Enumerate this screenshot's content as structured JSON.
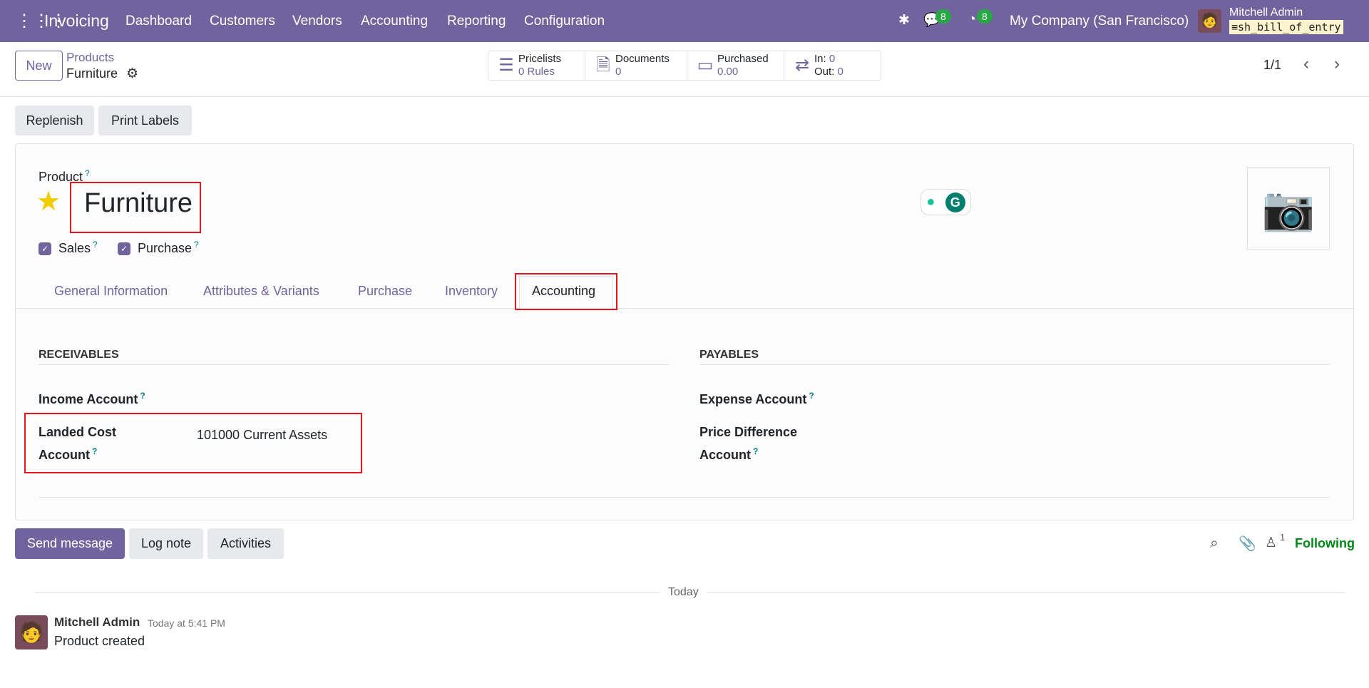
{
  "nav": {
    "app": "Invoicing",
    "menus": [
      "Dashboard",
      "Customers",
      "Vendors",
      "Accounting",
      "Reporting",
      "Configuration"
    ],
    "messages_count": "8",
    "activities_count": "8",
    "company": "My Company (San Francisco)",
    "user": "Mitchell Admin",
    "database": "sh_bill_of_entry"
  },
  "control": {
    "new_label": "New",
    "breadcrumb_parent": "Products",
    "breadcrumb_current": "Furniture",
    "pager": "1/1",
    "stats": {
      "pricelists_label": "Pricelists",
      "pricelists_value": "0 Rules",
      "documents_label": "Documents",
      "documents_value": "0",
      "purchased_label": "Purchased",
      "purchased_value": "0.00",
      "in_label": "In:",
      "in_value": "0",
      "out_label": "Out:",
      "out_value": "0"
    }
  },
  "actions": {
    "replenish": "Replenish",
    "print_labels": "Print Labels"
  },
  "form": {
    "product_label": "Product",
    "q": "?",
    "name": "Furniture",
    "sales_label": "Sales",
    "purchase_label": "Purchase",
    "tabs": [
      "General Information",
      "Attributes & Variants",
      "Purchase",
      "Inventory",
      "Accounting"
    ],
    "receivables": "RECEIVABLES",
    "payables": "PAYABLES",
    "income_account": "Income Account",
    "landed_cost_1": "Landed Cost",
    "landed_cost_2": "Account",
    "landed_cost_value": "101000 Current Assets",
    "expense_account": "Expense Account",
    "price_diff_1": "Price Difference",
    "price_diff_2": "Account"
  },
  "chatter": {
    "send_message": "Send message",
    "log_note": "Log note",
    "activities": "Activities",
    "followers_count": "1",
    "following": "Following",
    "today": "Today",
    "message": {
      "author": "Mitchell Admin",
      "time": "Today at 5:41 PM",
      "body": "Product created"
    }
  },
  "colors": {
    "brand": "#71639e",
    "highlight": "#e8141c",
    "following": "#008818"
  }
}
